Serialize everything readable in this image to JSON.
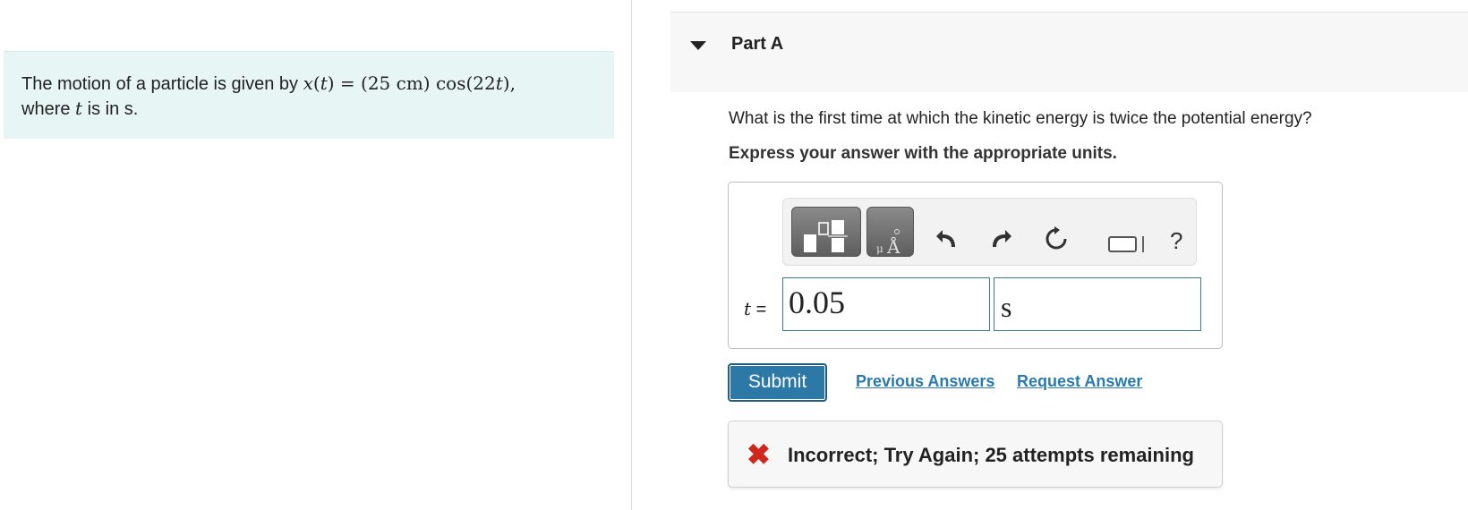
{
  "problem": {
    "prefix": "The motion of a particle is given by ",
    "equation": {
      "lhs_var": "x",
      "lhs_arg": "t",
      "rhs": "(25 cm) cos(22",
      "rhs_var": "t",
      "rhs_end": "),"
    },
    "line2_pre": "where ",
    "line2_var": "t",
    "line2_post": " is in s."
  },
  "part": {
    "title": "Part A",
    "question": "What is the first time at which the kinetic energy is twice the potential energy?",
    "instruction": "Express your answer with the appropriate units."
  },
  "toolbar": {
    "icons": [
      "templates-icon",
      "units-icon",
      "undo-icon",
      "redo-icon",
      "reset-icon",
      "keyboard-icon",
      "help-icon"
    ],
    "help_label": "?"
  },
  "answer": {
    "variable": "t",
    "equals": "=",
    "value": "0.05",
    "unit": "s"
  },
  "actions": {
    "submit_label": "Submit",
    "previous_answers_label": "Previous Answers",
    "request_answer_label": "Request Answer"
  },
  "feedback": {
    "status": "incorrect",
    "message": "Incorrect; Try Again; 25 attempts remaining",
    "color": "#d0271d"
  },
  "colors": {
    "problem_bg": "#e8f5f5",
    "submit_bg": "#2c79a8",
    "link": "#2a7aaa",
    "input_border": "#3d7a8e"
  }
}
